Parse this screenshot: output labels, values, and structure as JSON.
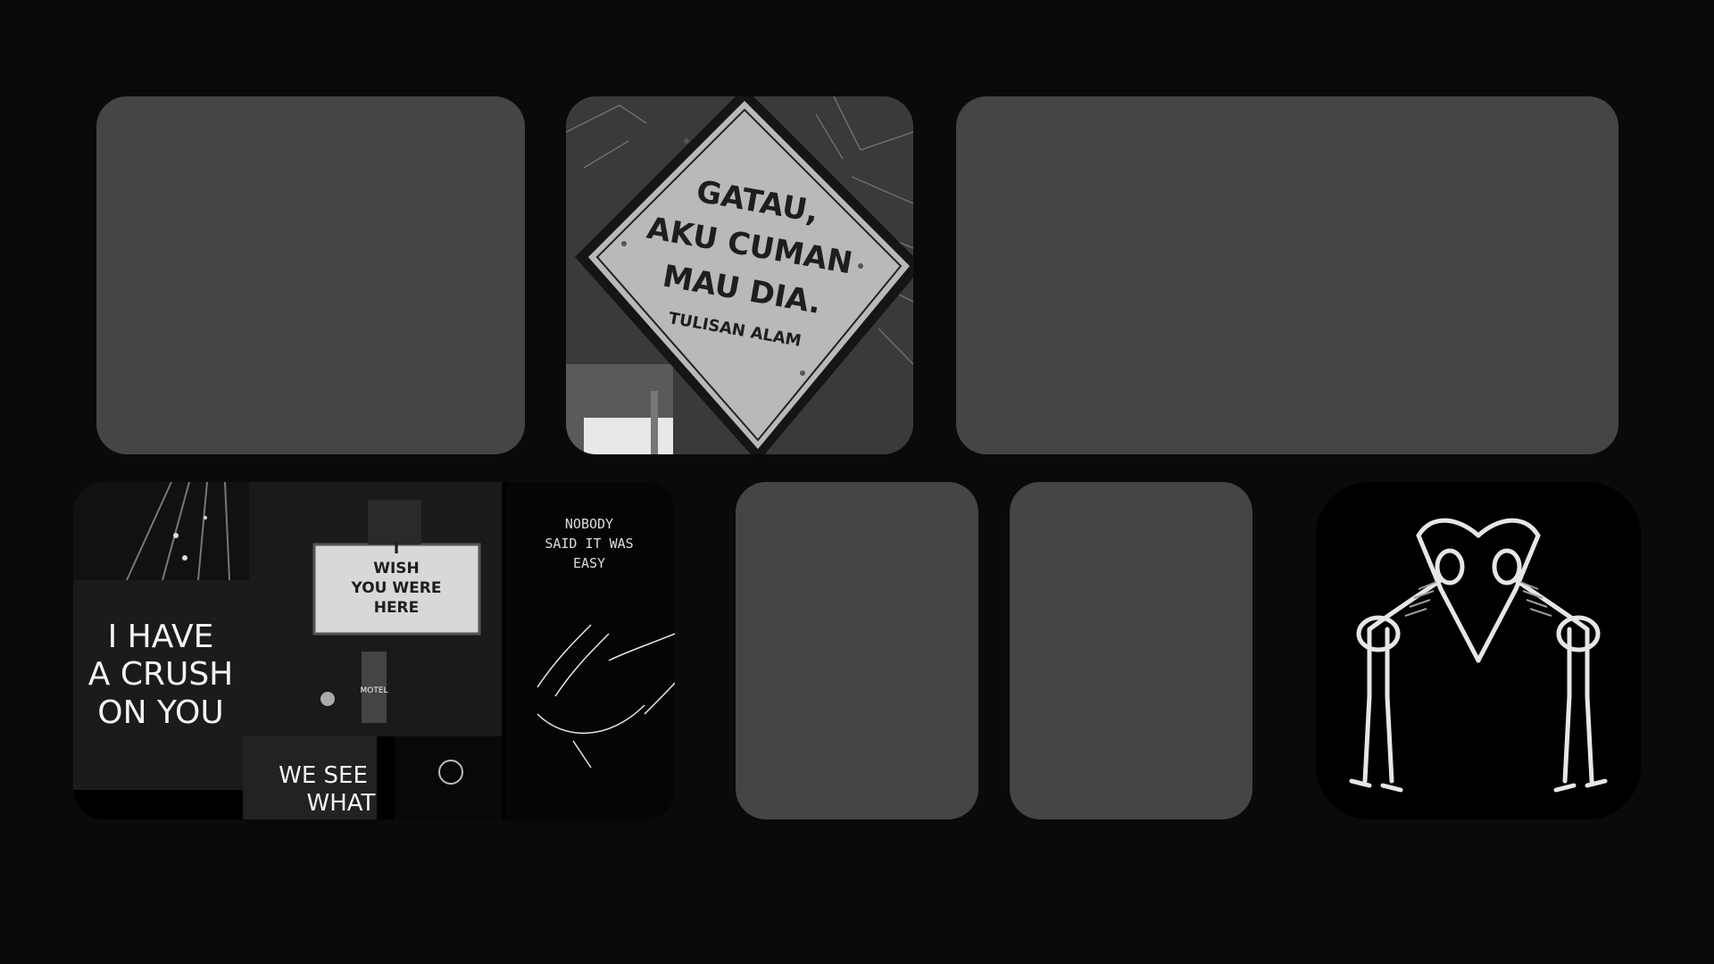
{
  "tiles": {
    "sign": {
      "lines": [
        "GATAU,",
        "AKU CUMAN",
        "MAU DIA."
      ],
      "caption": "TULISAN ALAM"
    },
    "collage": {
      "neon_lines": [
        "I HAVE",
        "A CRUSH",
        "ON YOU"
      ],
      "marquee_lines": [
        "I",
        "WISH",
        "YOU WERE",
        "HERE"
      ],
      "motel_label": "MOTEL",
      "we_see_lines": [
        "WE SEE",
        "WHAT"
      ],
      "poster_lines": [
        "NOBODY",
        "SAID IT WAS",
        "EASY"
      ]
    }
  },
  "colors": {
    "background": "#0a0a0a",
    "placeholder": "#454545"
  }
}
